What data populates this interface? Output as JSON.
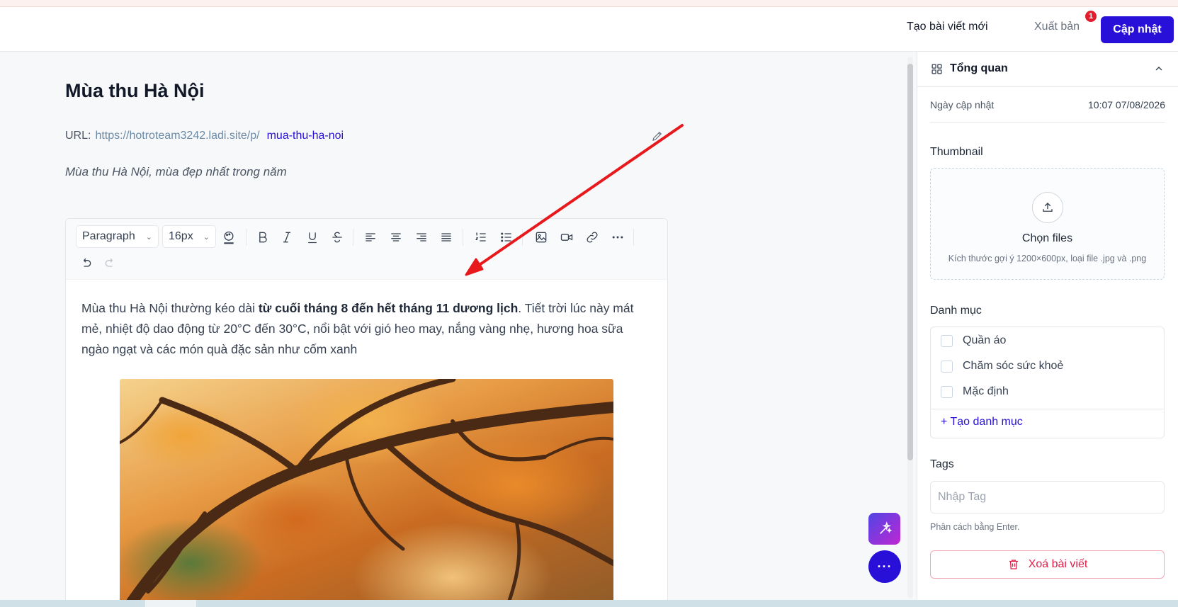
{
  "topbar": {
    "new_post": "Tạo bài viết mới",
    "publish": "Xuất bản",
    "publish_badge": "1",
    "update": "Cập nhật"
  },
  "post": {
    "title": "Mùa thu Hà Nội",
    "url_label": "URL:",
    "url_base": "https://hotroteam3242.ladi.site/p/",
    "url_slug": "mua-thu-ha-noi",
    "excerpt": "Mùa thu Hà Nội, mùa đẹp nhất trong năm"
  },
  "editor": {
    "block_type": "Paragraph",
    "font_size": "16px",
    "content_before_bold": "Mùa thu Hà Nội thường kéo dài ",
    "content_bold": "từ cuối tháng 8 đến hết tháng 11 dương lịch",
    "content_after_bold": ". Tiết trời lúc này mát mẻ, nhiệt độ dao động từ 20°C đến 30°C, nổi bật với gió heo may, nắng vàng nhẹ, hương hoa sữa ngào ngạt và các món quà đặc sản như cốm xanh"
  },
  "sidebar": {
    "overview_title": "Tổng quan",
    "updated_label": "Ngày cập nhật",
    "updated_value": "10:07 07/08/2026",
    "thumbnail_label": "Thumbnail",
    "choose_files": "Chọn files",
    "thumbnail_hint": "Kích thước gợi ý 1200×600px, loại file .jpg và .png",
    "category_label": "Danh mục",
    "categories": [
      "Quần áo",
      "Chăm sóc sức khoẻ",
      "Mặc định"
    ],
    "add_category": "+ Tạo danh mục",
    "tags_label": "Tags",
    "tags_placeholder": "Nhập Tag",
    "tags_hint": "Phân cách bằng Enter.",
    "delete_post": "Xoá bài viết"
  },
  "colors": {
    "primary": "#2810d9",
    "danger": "#e11d48",
    "annotation_arrow": "#e8191c"
  }
}
